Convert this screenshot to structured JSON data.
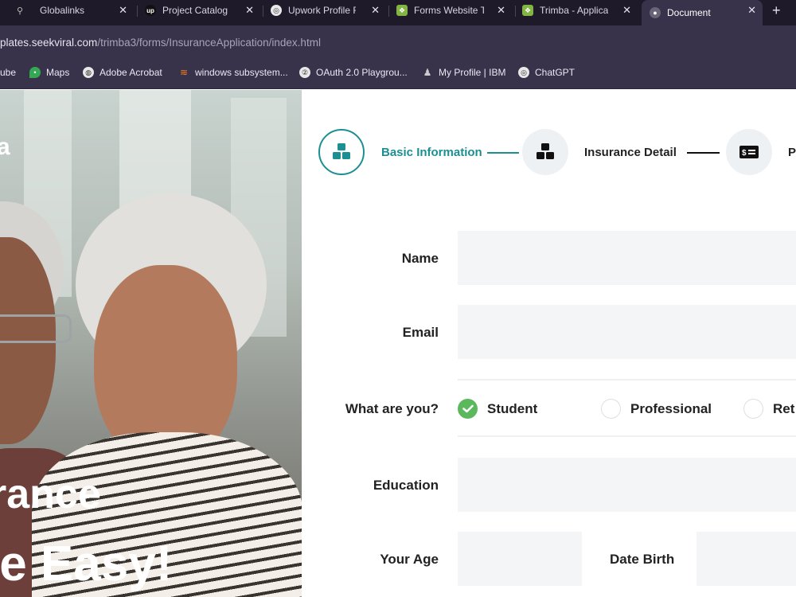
{
  "browser": {
    "tabs": [
      {
        "label": "Globalinks",
        "icon": "search-favicon"
      },
      {
        "label": "Project Catalog",
        "icon": "upwork-favicon"
      },
      {
        "label": "Upwork Profile F",
        "icon": "openai-favicon"
      },
      {
        "label": "Forms Website T",
        "icon": "envato-favicon"
      },
      {
        "label": "Trimba - Applica",
        "icon": "envato-favicon"
      },
      {
        "label": "Document",
        "icon": "globe-favicon",
        "active": true
      }
    ],
    "new_tab": "+",
    "url_host": "plates.seekviral.com",
    "url_path": "/trimba3/forms/InsuranceApplication/index.html",
    "bookmarks": [
      {
        "label": "ube",
        "icon": "youtube-icon"
      },
      {
        "label": "Maps",
        "icon": "maps-pin-icon"
      },
      {
        "label": "Adobe Acrobat",
        "icon": "acrobat-icon"
      },
      {
        "label": "windows subsystem...",
        "icon": "stack-icon"
      },
      {
        "label": "OAuth 2.0 Playgrou...",
        "icon": "oauth-icon"
      },
      {
        "label": "My Profile | IBM",
        "icon": "ibm-icon"
      },
      {
        "label": "ChatGPT",
        "icon": "openai-icon"
      }
    ]
  },
  "hero": {
    "brand_fragment": "a",
    "headline_line1": "rance",
    "headline_line2": "le Easy!"
  },
  "steps": [
    {
      "label": "Basic Information",
      "icon": "blocks-icon",
      "active": true
    },
    {
      "label": "Insurance Detail",
      "icon": "blocks-icon",
      "active": false
    },
    {
      "label": "P",
      "icon": "money-card-icon",
      "active": false
    }
  ],
  "form": {
    "name_label": "Name",
    "name_value": "",
    "email_label": "Email",
    "email_value": "",
    "role_label": "What are you?",
    "roles": [
      {
        "label": "Student",
        "checked": true
      },
      {
        "label": "Professional",
        "checked": false
      },
      {
        "label": "Ret",
        "checked": false
      }
    ],
    "education_label": "Education",
    "education_value": "",
    "age_label": "Your Age",
    "age_value": "",
    "birth_label": "Date Birth",
    "birth_value": ""
  },
  "colors": {
    "accent": "#1c8f93",
    "checked": "#5cb85c",
    "field_bg": "#f4f5f7",
    "chrome_dark": "#1e1a29",
    "chrome": "#38324a"
  }
}
